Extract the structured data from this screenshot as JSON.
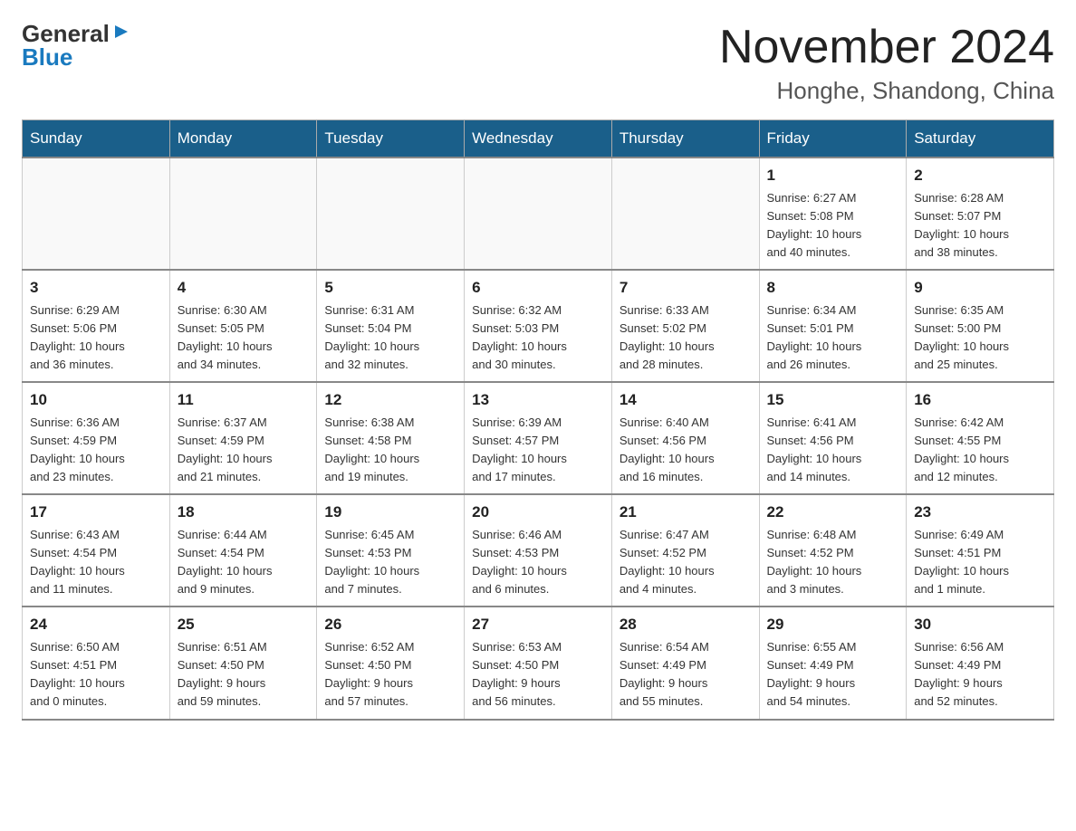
{
  "logo": {
    "general": "General",
    "blue": "Blue",
    "arrow": "▶"
  },
  "header": {
    "month_year": "November 2024",
    "location": "Honghe, Shandong, China"
  },
  "days_of_week": [
    "Sunday",
    "Monday",
    "Tuesday",
    "Wednesday",
    "Thursday",
    "Friday",
    "Saturday"
  ],
  "weeks": [
    [
      {
        "day": "",
        "info": ""
      },
      {
        "day": "",
        "info": ""
      },
      {
        "day": "",
        "info": ""
      },
      {
        "day": "",
        "info": ""
      },
      {
        "day": "",
        "info": ""
      },
      {
        "day": "1",
        "info": "Sunrise: 6:27 AM\nSunset: 5:08 PM\nDaylight: 10 hours\nand 40 minutes."
      },
      {
        "day": "2",
        "info": "Sunrise: 6:28 AM\nSunset: 5:07 PM\nDaylight: 10 hours\nand 38 minutes."
      }
    ],
    [
      {
        "day": "3",
        "info": "Sunrise: 6:29 AM\nSunset: 5:06 PM\nDaylight: 10 hours\nand 36 minutes."
      },
      {
        "day": "4",
        "info": "Sunrise: 6:30 AM\nSunset: 5:05 PM\nDaylight: 10 hours\nand 34 minutes."
      },
      {
        "day": "5",
        "info": "Sunrise: 6:31 AM\nSunset: 5:04 PM\nDaylight: 10 hours\nand 32 minutes."
      },
      {
        "day": "6",
        "info": "Sunrise: 6:32 AM\nSunset: 5:03 PM\nDaylight: 10 hours\nand 30 minutes."
      },
      {
        "day": "7",
        "info": "Sunrise: 6:33 AM\nSunset: 5:02 PM\nDaylight: 10 hours\nand 28 minutes."
      },
      {
        "day": "8",
        "info": "Sunrise: 6:34 AM\nSunset: 5:01 PM\nDaylight: 10 hours\nand 26 minutes."
      },
      {
        "day": "9",
        "info": "Sunrise: 6:35 AM\nSunset: 5:00 PM\nDaylight: 10 hours\nand 25 minutes."
      }
    ],
    [
      {
        "day": "10",
        "info": "Sunrise: 6:36 AM\nSunset: 4:59 PM\nDaylight: 10 hours\nand 23 minutes."
      },
      {
        "day": "11",
        "info": "Sunrise: 6:37 AM\nSunset: 4:59 PM\nDaylight: 10 hours\nand 21 minutes."
      },
      {
        "day": "12",
        "info": "Sunrise: 6:38 AM\nSunset: 4:58 PM\nDaylight: 10 hours\nand 19 minutes."
      },
      {
        "day": "13",
        "info": "Sunrise: 6:39 AM\nSunset: 4:57 PM\nDaylight: 10 hours\nand 17 minutes."
      },
      {
        "day": "14",
        "info": "Sunrise: 6:40 AM\nSunset: 4:56 PM\nDaylight: 10 hours\nand 16 minutes."
      },
      {
        "day": "15",
        "info": "Sunrise: 6:41 AM\nSunset: 4:56 PM\nDaylight: 10 hours\nand 14 minutes."
      },
      {
        "day": "16",
        "info": "Sunrise: 6:42 AM\nSunset: 4:55 PM\nDaylight: 10 hours\nand 12 minutes."
      }
    ],
    [
      {
        "day": "17",
        "info": "Sunrise: 6:43 AM\nSunset: 4:54 PM\nDaylight: 10 hours\nand 11 minutes."
      },
      {
        "day": "18",
        "info": "Sunrise: 6:44 AM\nSunset: 4:54 PM\nDaylight: 10 hours\nand 9 minutes."
      },
      {
        "day": "19",
        "info": "Sunrise: 6:45 AM\nSunset: 4:53 PM\nDaylight: 10 hours\nand 7 minutes."
      },
      {
        "day": "20",
        "info": "Sunrise: 6:46 AM\nSunset: 4:53 PM\nDaylight: 10 hours\nand 6 minutes."
      },
      {
        "day": "21",
        "info": "Sunrise: 6:47 AM\nSunset: 4:52 PM\nDaylight: 10 hours\nand 4 minutes."
      },
      {
        "day": "22",
        "info": "Sunrise: 6:48 AM\nSunset: 4:52 PM\nDaylight: 10 hours\nand 3 minutes."
      },
      {
        "day": "23",
        "info": "Sunrise: 6:49 AM\nSunset: 4:51 PM\nDaylight: 10 hours\nand 1 minute."
      }
    ],
    [
      {
        "day": "24",
        "info": "Sunrise: 6:50 AM\nSunset: 4:51 PM\nDaylight: 10 hours\nand 0 minutes."
      },
      {
        "day": "25",
        "info": "Sunrise: 6:51 AM\nSunset: 4:50 PM\nDaylight: 9 hours\nand 59 minutes."
      },
      {
        "day": "26",
        "info": "Sunrise: 6:52 AM\nSunset: 4:50 PM\nDaylight: 9 hours\nand 57 minutes."
      },
      {
        "day": "27",
        "info": "Sunrise: 6:53 AM\nSunset: 4:50 PM\nDaylight: 9 hours\nand 56 minutes."
      },
      {
        "day": "28",
        "info": "Sunrise: 6:54 AM\nSunset: 4:49 PM\nDaylight: 9 hours\nand 55 minutes."
      },
      {
        "day": "29",
        "info": "Sunrise: 6:55 AM\nSunset: 4:49 PM\nDaylight: 9 hours\nand 54 minutes."
      },
      {
        "day": "30",
        "info": "Sunrise: 6:56 AM\nSunset: 4:49 PM\nDaylight: 9 hours\nand 52 minutes."
      }
    ]
  ]
}
